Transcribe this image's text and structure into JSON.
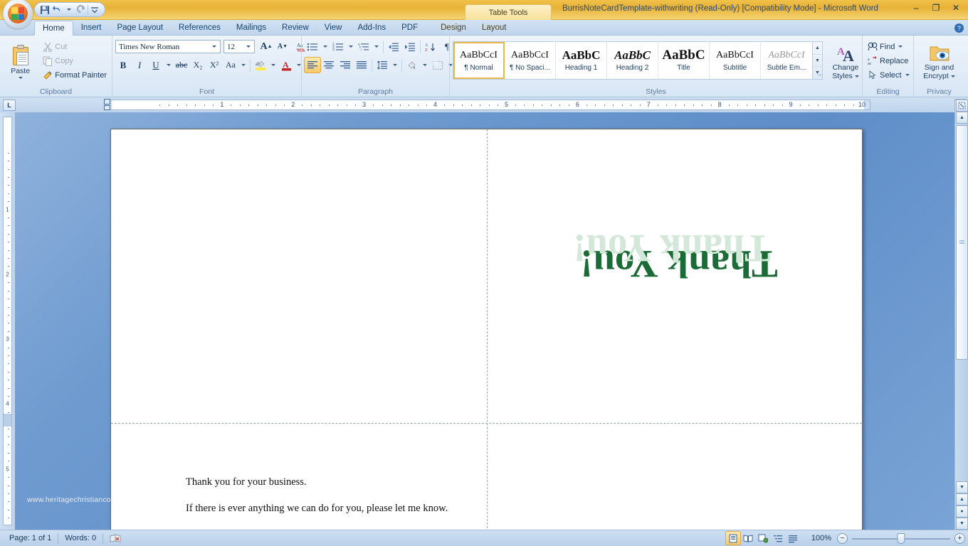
{
  "window": {
    "title": "BurrisNoteCardTemplate-withwriting (Read-Only) [Compatibility Mode] - Microsoft Word",
    "contextual_tab_group": "Table Tools",
    "minimize": "–",
    "restore": "❐",
    "close": "✕",
    "help": "?"
  },
  "quick_access": {
    "save": "save-icon",
    "undo": "undo-icon",
    "redo": "redo-icon",
    "customize": "customize-icon"
  },
  "tabs": [
    {
      "label": "Home",
      "active": true
    },
    {
      "label": "Insert",
      "active": false
    },
    {
      "label": "Page Layout",
      "active": false
    },
    {
      "label": "References",
      "active": false
    },
    {
      "label": "Mailings",
      "active": false
    },
    {
      "label": "Review",
      "active": false
    },
    {
      "label": "View",
      "active": false
    },
    {
      "label": "Add-Ins",
      "active": false
    },
    {
      "label": "PDF",
      "active": false
    },
    {
      "label": "Design",
      "active": false,
      "contextual": true
    },
    {
      "label": "Layout",
      "active": false,
      "contextual": true
    }
  ],
  "ribbon": {
    "clipboard": {
      "label": "Clipboard",
      "paste": "Paste",
      "cut": "Cut",
      "copy": "Copy",
      "format_painter": "Format Painter"
    },
    "font": {
      "label": "Font",
      "font_name": "Times New Roman",
      "font_size": "12",
      "grow_font": "A",
      "shrink_font": "A",
      "clear_formatting": "Aa",
      "bold": "B",
      "italic": "I",
      "underline": "U",
      "strikethrough": "abc",
      "subscript": "X₂",
      "superscript": "X²",
      "change_case": "Aa",
      "highlight": "ab",
      "font_color": "A"
    },
    "paragraph": {
      "label": "Paragraph",
      "bullets": "bullets-icon",
      "numbering": "numbering-icon",
      "multilevel": "multilevel-list-icon",
      "decrease_indent": "decrease-indent-icon",
      "increase_indent": "increase-indent-icon",
      "sort": "sort-icon",
      "show_marks": "¶",
      "align_left": "align-left-icon",
      "align_center": "align-center-icon",
      "align_right": "align-right-icon",
      "justify": "justify-icon",
      "line_spacing": "line-spacing-icon",
      "shading": "shading-icon",
      "borders": "borders-icon"
    },
    "styles": {
      "label": "Styles",
      "items": [
        {
          "preview": "AaBbCcI",
          "name": "¶ Normal",
          "selected": true
        },
        {
          "preview": "AaBbCcI",
          "name": "¶ No Spaci...",
          "selected": false
        },
        {
          "preview": "AaBbC",
          "name": "Heading 1",
          "selected": false
        },
        {
          "preview": "AaBbC",
          "name": "Heading 2",
          "selected": false
        },
        {
          "preview": "AaBbC",
          "name": "Title",
          "selected": false
        },
        {
          "preview": "AaBbCcI",
          "name": "Subtitle",
          "selected": false
        },
        {
          "preview": "AaBbCcI",
          "name": "Subtle Em...",
          "selected": false
        }
      ],
      "change_styles_line1": "Change",
      "change_styles_line2": "Styles"
    },
    "editing": {
      "label": "Editing",
      "find": "Find",
      "replace": "Replace",
      "select": "Select"
    },
    "privacy": {
      "label": "Privacy",
      "sign_line1": "Sign and",
      "sign_line2": "Encrypt"
    }
  },
  "ruler": {
    "tab_stop": "L",
    "h_numbers": [
      "1",
      "2",
      "3",
      "4",
      "5",
      "6",
      "7",
      "8",
      "9",
      "10"
    ],
    "v_numbers": [
      "1",
      "2",
      "3",
      "4",
      "5"
    ]
  },
  "document": {
    "headline": "Thank You!",
    "headline_color": "#1a6b35",
    "headline_shadow_color": "#d4e8da",
    "paragraphs": [
      "Thank you for your business.",
      "If there is ever anything we can do for you, please let me know."
    ],
    "watermark": "www.heritagechristianco"
  },
  "status_bar": {
    "page": "Page: 1 of 1",
    "words": "Words: 0",
    "proofing": "proofing-errors-icon",
    "views": [
      {
        "name": "print-layout",
        "active": true
      },
      {
        "name": "full-screen-reading",
        "active": false
      },
      {
        "name": "web-layout",
        "active": false
      },
      {
        "name": "outline",
        "active": false
      },
      {
        "name": "draft",
        "active": false
      }
    ],
    "zoom": "100%",
    "zoom_out": "−",
    "zoom_in": "+"
  }
}
